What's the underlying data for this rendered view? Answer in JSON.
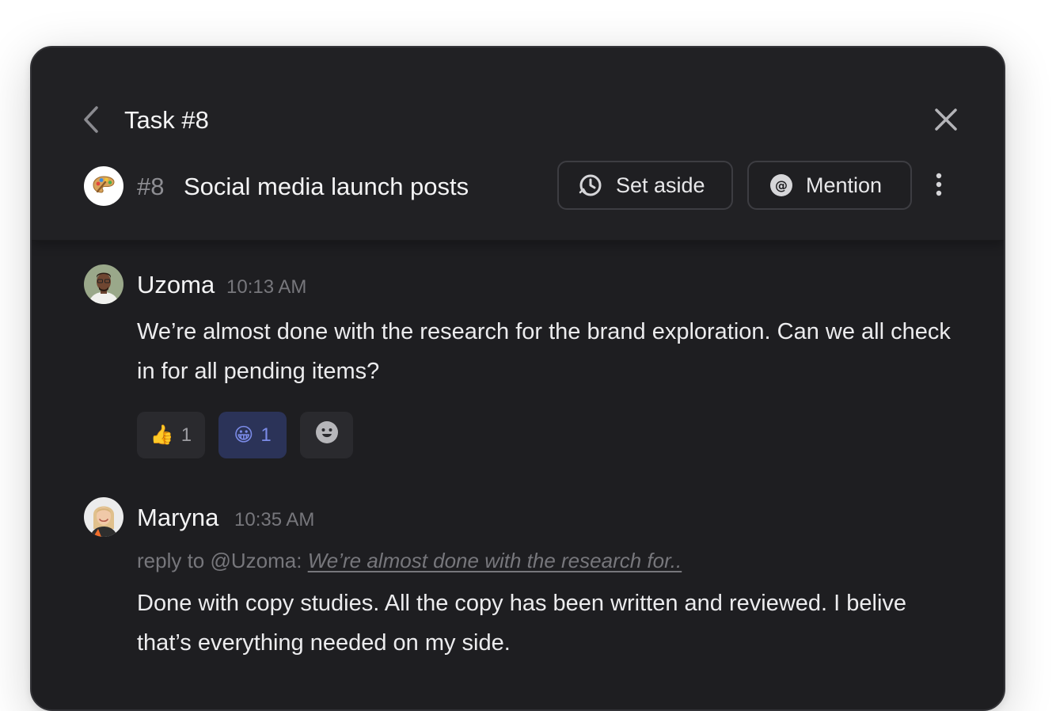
{
  "panel": {
    "title": "Task #8"
  },
  "task": {
    "number": "#8",
    "title": "Social media launch posts",
    "avatar_icon": "palette-icon"
  },
  "actions": {
    "set_aside_label": "Set aside",
    "set_aside_icon": "clock-arrow-icon",
    "mention_label": "Mention",
    "mention_icon": "at-sign-icon"
  },
  "messages": [
    {
      "author": "Uzoma",
      "time": "10:13 AM",
      "text": "We’re almost done with the research for the brand exploration. Can we all check  in for all pending items?",
      "reactions": [
        {
          "emoji": "👍",
          "count": "1",
          "active": false
        },
        {
          "emoji": "😀",
          "count": "1",
          "active": true
        }
      ],
      "add_reaction_icon": "smiley-add-icon"
    },
    {
      "author": "Maryna",
      "time": "10:35 AM",
      "reply_prefix": "reply to @Uzoma: ",
      "reply_quote": "We’re almost done with the research for..",
      "text": "Done with copy studies. All the copy has been written and reviewed. I belive that’s everything needed on my side."
    }
  ],
  "colors": {
    "panel_bg": "#1e1e21",
    "header_bg": "#212124",
    "active_reaction_bg": "#2b3358",
    "active_reaction_text": "#7b8be8",
    "muted_text": "#77777c"
  }
}
